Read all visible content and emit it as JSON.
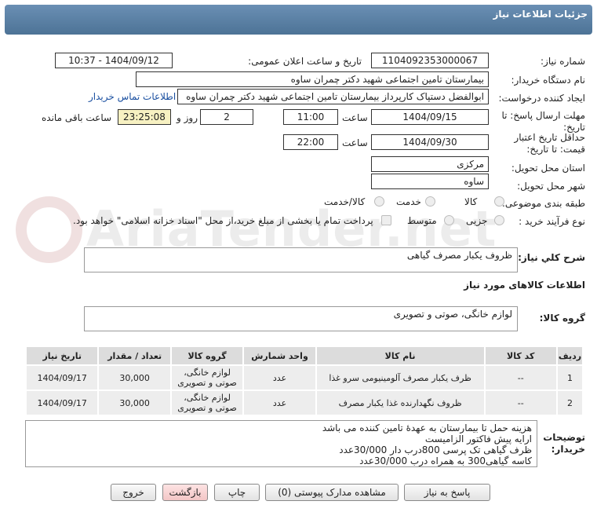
{
  "header": {
    "title": "جزئیات اطلاعات نیاز"
  },
  "watermark": {
    "text": "AriaTender.net"
  },
  "form": {
    "need_number_label": "شماره نیاز:",
    "need_number": "1104092353000067",
    "announce_label": "تاریخ و ساعت اعلان عمومی:",
    "announce_value": "1404/09/12 - 10:37",
    "buyer_label": "نام دستگاه خریدار:",
    "buyer_value": "بیمارستان تامین اجتماعی شهید دکتر چمران ساوه",
    "creator_label": "ایجاد کننده درخواست:",
    "creator_value": "ابوالفضل  دستپاک  کارپرداز بیمارستان تامین اجتماعی شهید دکتر چمران ساوه",
    "contact_link": "اطلاعات تماس خریدار",
    "deadline_label": "مهلت ارسال پاسخ: تا تاریخ:",
    "deadline_date": "1404/09/15",
    "time_label": "ساعت",
    "deadline_time": "11:00",
    "days_value": "2",
    "days_label": "روز و",
    "remaining_time": "23:25:08",
    "remaining_label": "ساعت باقی مانده",
    "validity_label": "حداقل تاریخ اعتبار قیمت: تا تاریخ:",
    "validity_date": "1404/09/30",
    "validity_time": "22:00",
    "province_label": "استان محل تحویل:",
    "province_value": "مرکزی",
    "city_label": "شهر محل تحویل:",
    "city_value": "ساوه",
    "category_label": "طبقه بندی موضوعی:",
    "category_options": [
      "کالا",
      "خدمت",
      "کالا/خدمت"
    ],
    "process_label": "نوع فرآیند خرید :",
    "process_options": [
      "جزیی",
      "متوسط"
    ],
    "payment_text": "پرداخت تمام یا بخشی از مبلغ خرید،از محل \"اسناد خزانه اسلامی\" خواهد بود."
  },
  "summary": {
    "label": "شرح کلي نياز:",
    "value": "ظروف یکبار مصرف گیاهی"
  },
  "goods_info": {
    "title": "اطلاعات کالاهای مورد نیاز"
  },
  "goods_group": {
    "label": "گروه کالا:",
    "value": "لوازم خانگی، صوتی و تصویری"
  },
  "table": {
    "headers": [
      "ردیف",
      "کد کالا",
      "نام کالا",
      "واحد شمارش",
      "گروه کالا",
      "تعداد / مقدار",
      "تاریخ نیاز"
    ],
    "rows": [
      {
        "row": "1",
        "code": "--",
        "name": "ظرف یکبار مصرف آلومینیومی سرو غذا",
        "unit": "عدد",
        "group": "لوازم خانگی، صوتی و تصویری",
        "qty": "30,000",
        "date": "1404/09/17"
      },
      {
        "row": "2",
        "code": "--",
        "name": "ظروف نگهدارنده غذا یکبار مصرف",
        "unit": "عدد",
        "group": "لوازم خانگی، صوتی و تصویری",
        "qty": "30,000",
        "date": "1404/09/17"
      }
    ]
  },
  "notes": {
    "label": "توضیحات خریدار:",
    "lines": [
      "هزینه حمل تا بیمارستان به عهدهٔ تامین کننده می باشد",
      "ارایه پیش فاکتور الزامیست",
      "ظرف گیاهی تک پرسی 800درب دار 30/000عدد",
      "کاسه گیاهی300 به همراه درب 30/000عدد"
    ]
  },
  "buttons": {
    "reply": "پاسخ به نیاز",
    "view_docs": "مشاهده مدارک پیوستی (0)",
    "print": "چاپ",
    "back": "بازگشت",
    "exit": "خروج"
  }
}
